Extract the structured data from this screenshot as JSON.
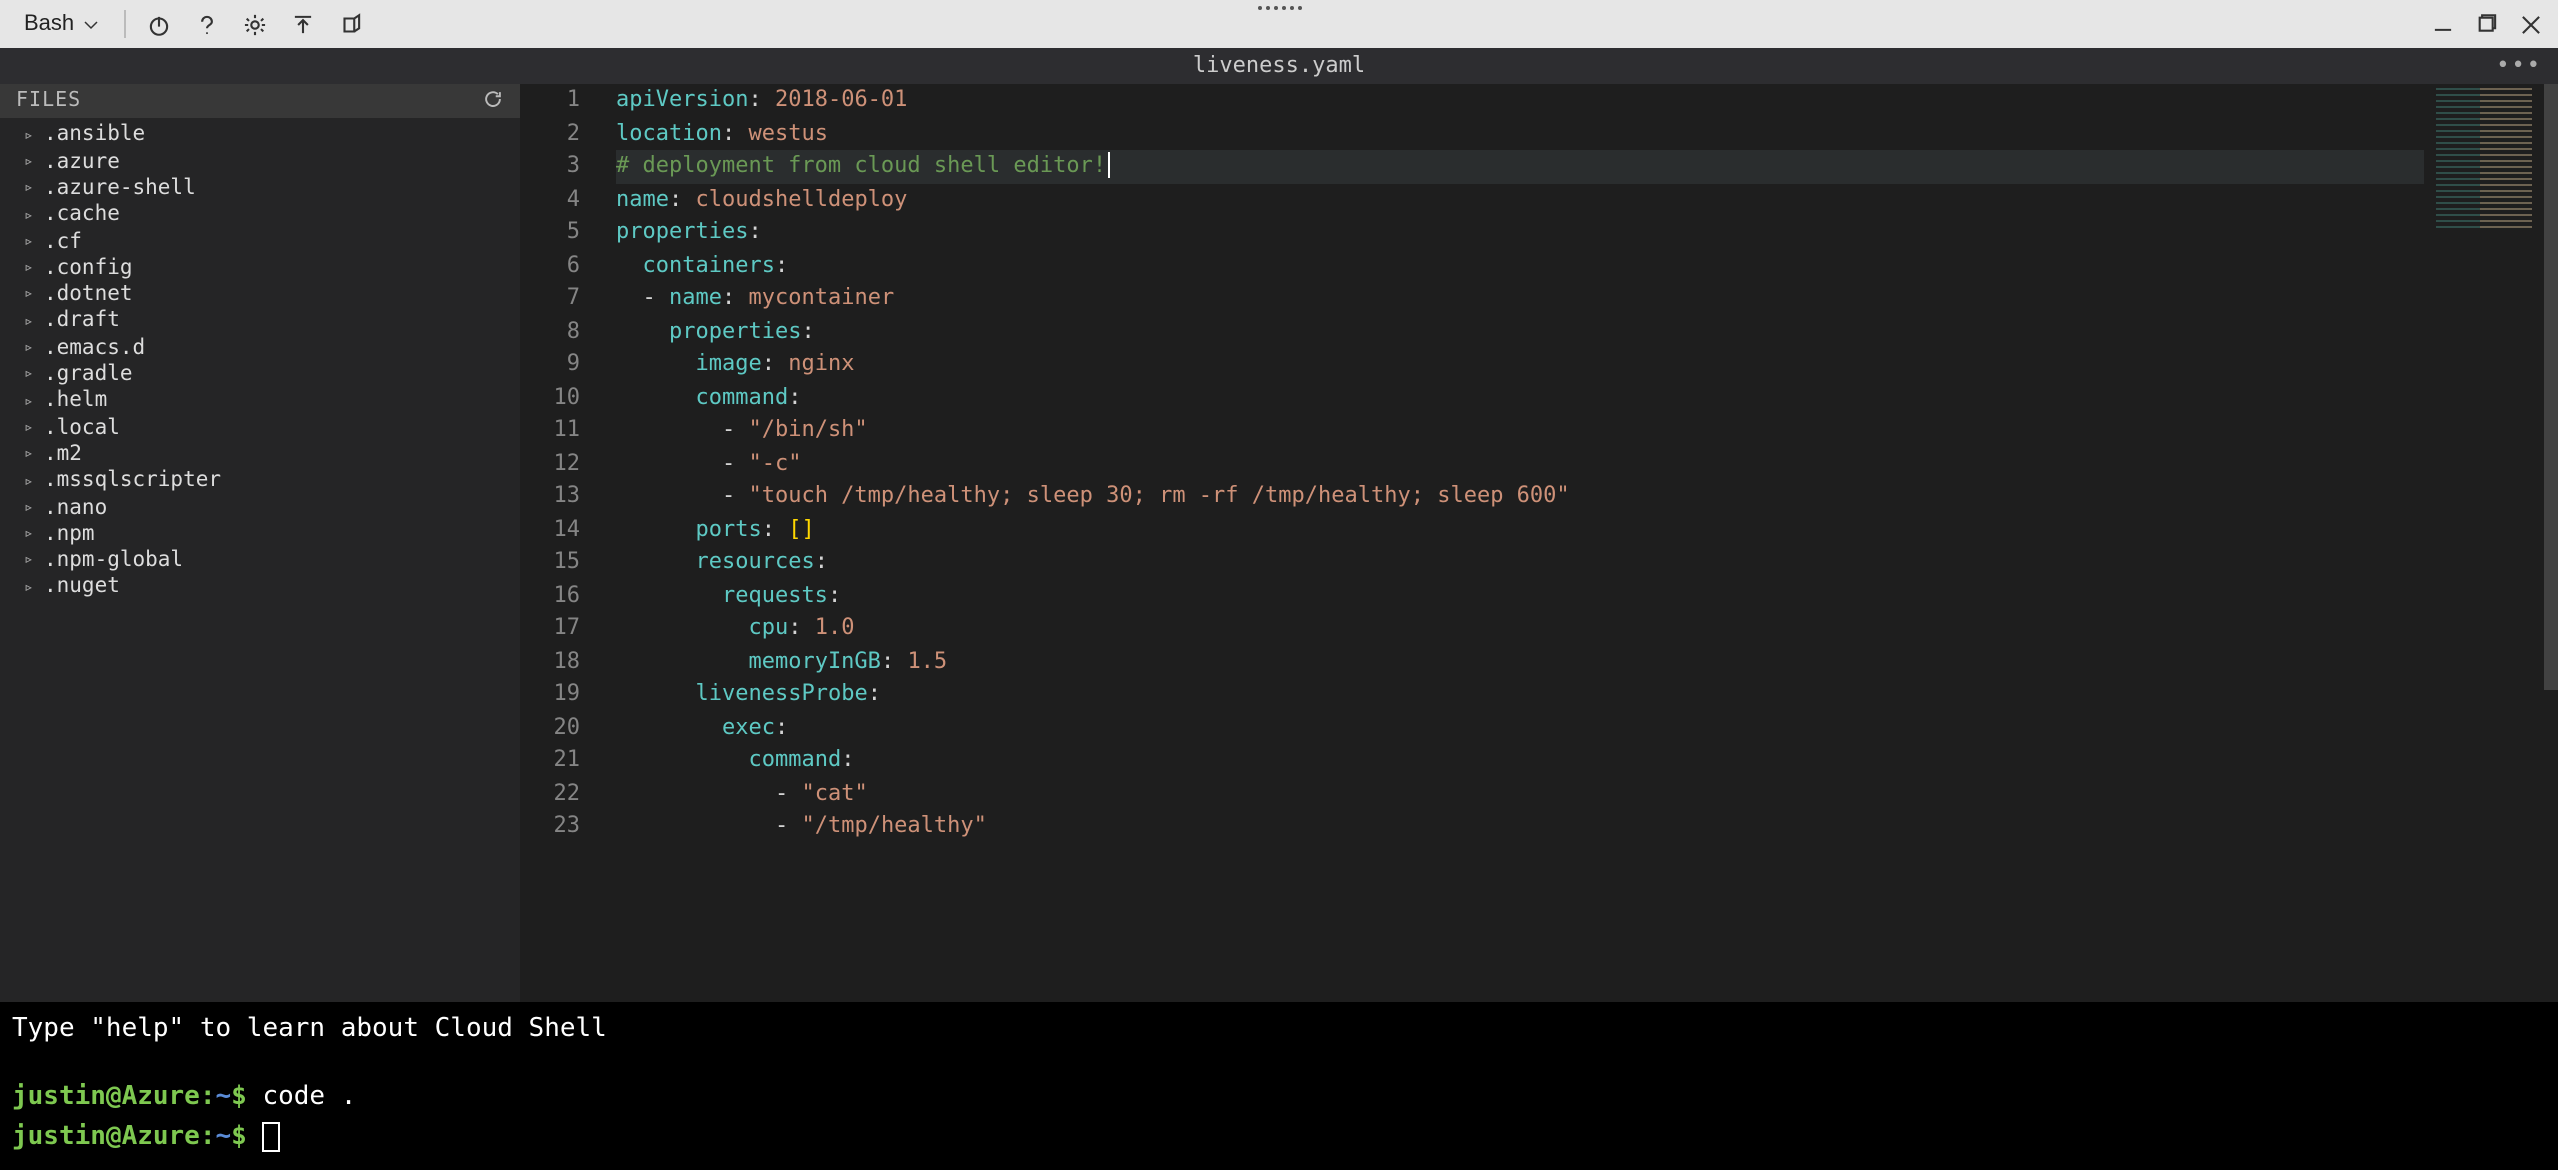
{
  "toolbar": {
    "shell_label": "Bash"
  },
  "editor": {
    "title": "liveness.yaml",
    "files_header": "FILES",
    "files": [
      ".ansible",
      ".azure",
      ".azure-shell",
      ".cache",
      ".cf",
      ".config",
      ".dotnet",
      ".draft",
      ".emacs.d",
      ".gradle",
      ".helm",
      ".local",
      ".m2",
      ".mssqlscripter",
      ".nano",
      ".npm",
      ".npm-global",
      ".nuget"
    ],
    "line_count": 23,
    "code": {
      "l1_key": "apiVersion",
      "l1_val": "2018-06-01",
      "l2_key": "location",
      "l2_val": "westus",
      "l3_comment": "# deployment from cloud shell editor!",
      "l4_key": "name",
      "l4_val": "cloudshelldeploy",
      "l5_key": "properties",
      "l6_key": "containers",
      "l7_key": "name",
      "l7_val": "mycontainer",
      "l8_key": "properties",
      "l9_key": "image",
      "l9_val": "nginx",
      "l10_key": "command",
      "l11_val": "\"/bin/sh\"",
      "l12_val": "\"-c\"",
      "l13_val": "\"touch /tmp/healthy; sleep 30; rm -rf /tmp/healthy; sleep 600\"",
      "l14_key": "ports",
      "l14_val": "[]",
      "l15_key": "resources",
      "l16_key": "requests",
      "l17_key": "cpu",
      "l17_val": "1.0",
      "l18_key": "memoryInGB",
      "l18_val": "1.5",
      "l19_key": "livenessProbe",
      "l20_key": "exec",
      "l21_key": "command",
      "l22_val": "\"cat\"",
      "l23_val": "\"/tmp/healthy\""
    }
  },
  "terminal": {
    "help_line": "Type \"help\" to learn about Cloud Shell",
    "prompt_user": "justin@Azure",
    "prompt_sep": ":",
    "prompt_path": "~",
    "prompt_symbol": "$",
    "command1": "code ."
  }
}
